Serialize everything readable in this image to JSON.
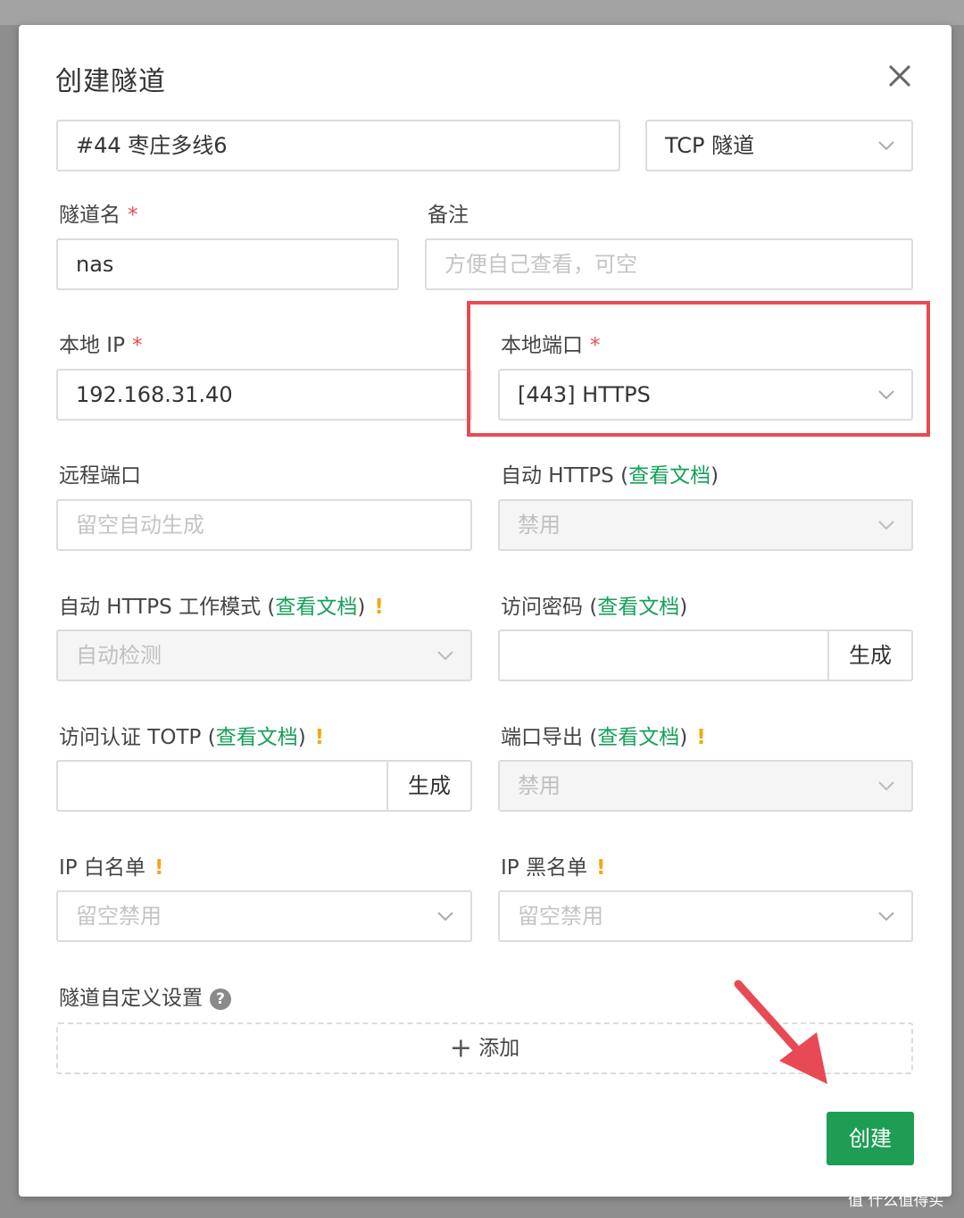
{
  "dialog": {
    "title": "创建隧道",
    "node_select": "#44 枣庄多线6",
    "type_select": "TCP 隧道",
    "tunnel_name": {
      "label": "隧道名",
      "value": "nas"
    },
    "remark": {
      "label": "备注",
      "placeholder": "方便自己查看，可空"
    },
    "local_ip": {
      "label": "本地 IP",
      "value": "192.168.31.40"
    },
    "local_port": {
      "label": "本地端口",
      "value": "[443] HTTPS"
    },
    "remote_port": {
      "label": "远程端口",
      "placeholder": "留空自动生成"
    },
    "auto_https": {
      "label": "自动 HTTPS",
      "value": "禁用"
    },
    "https_mode": {
      "label": "自动 HTTPS 工作模式",
      "value": "自动检测"
    },
    "access_password": {
      "label": "访问密码",
      "button": "生成"
    },
    "totp": {
      "label": "访问认证 TOTP",
      "button": "生成"
    },
    "port_export": {
      "label": "端口导出",
      "value": "禁用"
    },
    "ip_whitelist": {
      "label": "IP 白名单",
      "placeholder": "留空禁用"
    },
    "ip_blacklist": {
      "label": "IP 黑名单",
      "placeholder": "留空禁用"
    },
    "custom_settings": {
      "label": "隧道自定义设置",
      "help": "?"
    },
    "add_label": "添加",
    "create_button": "创建",
    "doc_link": "查看文档",
    "required_mark": "*",
    "warn_mark": "!",
    "paren_open": "(",
    "paren_close": ")"
  },
  "watermark": "值 什么值得买",
  "colors": {
    "accent": "#1e9e55",
    "link": "#16a05a",
    "required": "#e84c4c",
    "warning": "#f3a712",
    "annotation": "#e84a55"
  }
}
